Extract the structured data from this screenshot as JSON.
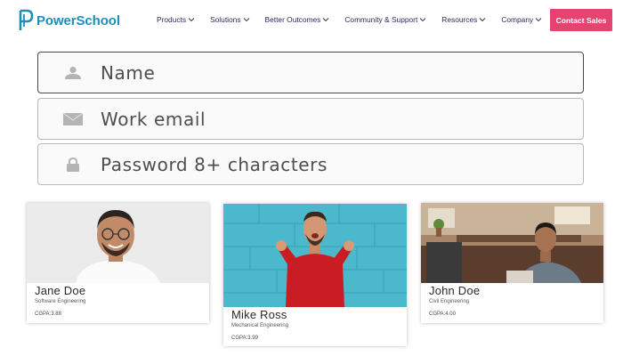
{
  "header": {
    "brand": "PowerSchool",
    "nav": [
      {
        "label": "Products"
      },
      {
        "label": "Solutions"
      },
      {
        "label": "Better Outcomes"
      },
      {
        "label": "Community & Support"
      },
      {
        "label": "Resources"
      },
      {
        "label": "Company"
      }
    ],
    "cta_label": "Contact Sales"
  },
  "form": {
    "fields": [
      {
        "placeholder": "Name",
        "icon": "user-icon"
      },
      {
        "placeholder": "Work email",
        "icon": "envelope-icon"
      },
      {
        "placeholder": "Password 8+ characters",
        "icon": "lock-icon"
      }
    ]
  },
  "cards": [
    {
      "name": "Jane Doe",
      "major": "Software Engineering",
      "gpa": "CGPA:3.88"
    },
    {
      "name": "Mike Ross",
      "major": "Mechanical Engineering",
      "gpa": "CGPA:3.99"
    },
    {
      "name": "John Doe",
      "major": "Civil Engineering",
      "gpa": "CGPA:4.00"
    }
  ],
  "colors": {
    "brand": "#1c8fb8",
    "nav_text": "#2b2a5e",
    "cta": "#e4446f"
  }
}
